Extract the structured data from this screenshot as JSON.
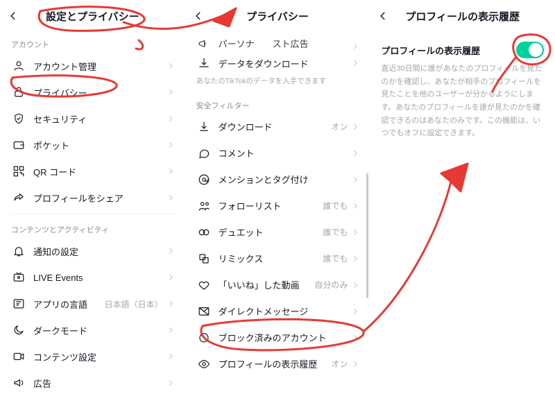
{
  "panel1": {
    "title": "設定とプライバシー",
    "sections": [
      {
        "label": "アカウント",
        "items": [
          {
            "icon": "user",
            "name": "account-manage",
            "label": "アカウント管理"
          },
          {
            "icon": "lock",
            "name": "privacy",
            "label": "プライバシー"
          },
          {
            "icon": "shield",
            "name": "security",
            "label": "セキュリティ"
          },
          {
            "icon": "wallet",
            "name": "pocket",
            "label": "ポケット"
          },
          {
            "icon": "qr",
            "name": "qr-code",
            "label": "QR コード"
          },
          {
            "icon": "share",
            "name": "share-profile",
            "label": "プロフィールをシェア"
          }
        ]
      },
      {
        "label": "コンテンツとアクティビティ",
        "items": [
          {
            "icon": "bell",
            "name": "notifications",
            "label": "通知の設定"
          },
          {
            "icon": "live",
            "name": "live-events",
            "label": "LIVE Events"
          },
          {
            "icon": "lang",
            "name": "app-language",
            "label": "アプリの言語",
            "value": "日本語（日本）"
          },
          {
            "icon": "moon",
            "name": "dark-mode",
            "label": "ダークモード"
          },
          {
            "icon": "video",
            "name": "content-settings",
            "label": "コンテンツ設定"
          },
          {
            "icon": "ads",
            "name": "ads",
            "label": "広告"
          }
        ]
      }
    ]
  },
  "panel2": {
    "title": "プライバシー",
    "top_items": [
      {
        "icon": "megaphone",
        "name": "personalized-ads",
        "label": "パーソナライズド広告"
      },
      {
        "icon": "download",
        "name": "download-data",
        "label": "データをダウンロード",
        "sub": "あなたのTikTokのデータを入手できます"
      }
    ],
    "section_label": "安全フィルター",
    "items": [
      {
        "icon": "dl",
        "name": "downloads",
        "label": "ダウンロード",
        "value": "オン"
      },
      {
        "icon": "comment",
        "name": "comments",
        "label": "コメント"
      },
      {
        "icon": "mention",
        "name": "mentions",
        "label": "メンションとタグ付け"
      },
      {
        "icon": "follow",
        "name": "follow-list",
        "label": "フォローリスト",
        "value": "誰でも"
      },
      {
        "icon": "duet",
        "name": "duet",
        "label": "デュエット",
        "value": "誰でも"
      },
      {
        "icon": "remix",
        "name": "remix",
        "label": "リミックス",
        "value": "誰でも"
      },
      {
        "icon": "heart",
        "name": "liked-videos",
        "label": "「いいね」した動画",
        "value": "自分のみ"
      },
      {
        "icon": "dm",
        "name": "direct-message",
        "label": "ダイレクトメッセージ"
      },
      {
        "icon": "block",
        "name": "blocked",
        "label": "ブロック済みのアカウント"
      },
      {
        "icon": "eye",
        "name": "profile-view-history",
        "label": "プロフィールの表示履歴",
        "value": "オン"
      }
    ]
  },
  "panel3": {
    "title": "プロフィールの表示履歴",
    "setting_label": "プロフィールの表示履歴",
    "toggle_on": true,
    "desc": "直近30日間に誰があなたのプロフィールを見たのかを確認し、あなたが相手のプロフィールを見たことを他のユーザーが分かるようにします。あなたのプロフィールを誰が見たのかを確認できるのはあなたのみです。この機能は、いつでもオフに設定できます。"
  }
}
